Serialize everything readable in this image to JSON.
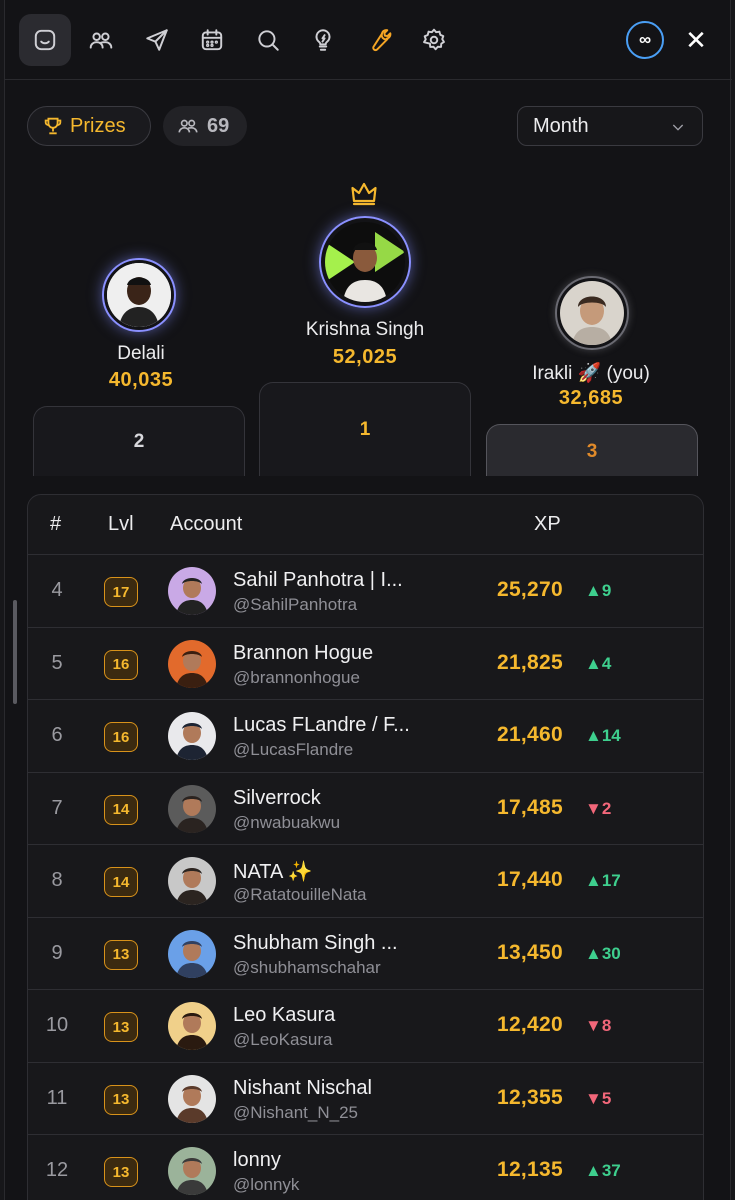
{
  "nav": {
    "items": [
      "home-icon",
      "users-icon",
      "send-icon",
      "calendar-icon",
      "search-icon",
      "lightbulb-icon",
      "wrench-icon",
      "gear-icon"
    ],
    "infinity_label": "∞",
    "close_label": "✕"
  },
  "filters": {
    "prizes_label": "Prizes",
    "members_count": "69",
    "period": "Month"
  },
  "podium": [
    {
      "place": "2",
      "name": "Delali",
      "xp": "40,035"
    },
    {
      "place": "1",
      "name": "Krishna Singh",
      "xp": "52,025"
    },
    {
      "place": "3",
      "name": "Irakli 🚀 (you)",
      "xp": "32,685"
    }
  ],
  "table": {
    "headers": {
      "rank": "#",
      "lvl": "Lvl",
      "account": "Account",
      "xp": "XP"
    },
    "rows": [
      {
        "rank": "4",
        "lvl": "17",
        "name": "Sahil Panhotra | I...",
        "handle": "@SahilPanhotra",
        "xp": "25,270",
        "change": "▲9",
        "dir": "up"
      },
      {
        "rank": "5",
        "lvl": "16",
        "name": "Brannon Hogue",
        "handle": "@brannonhogue",
        "xp": "21,825",
        "change": "▲4",
        "dir": "up"
      },
      {
        "rank": "6",
        "lvl": "16",
        "name": "Lucas FLandre / F...",
        "handle": "@LucasFlandre",
        "xp": "21,460",
        "change": "▲14",
        "dir": "up"
      },
      {
        "rank": "7",
        "lvl": "14",
        "name": "Silverrock",
        "handle": "@nwabuakwu",
        "xp": "17,485",
        "change": "▼2",
        "dir": "down"
      },
      {
        "rank": "8",
        "lvl": "14",
        "name": "NATA ✨",
        "handle": "@RatatouilleNata",
        "xp": "17,440",
        "change": "▲17",
        "dir": "up"
      },
      {
        "rank": "9",
        "lvl": "13",
        "name": "Shubham Singh ...",
        "handle": "@shubhamschahar",
        "xp": "13,450",
        "change": "▲30",
        "dir": "up"
      },
      {
        "rank": "10",
        "lvl": "13",
        "name": "Leo Kasura",
        "handle": "@LeoKasura",
        "xp": "12,420",
        "change": "▼8",
        "dir": "down"
      },
      {
        "rank": "11",
        "lvl": "13",
        "name": "Nishant Nischal",
        "handle": "@Nishant_N_25",
        "xp": "12,355",
        "change": "▼5",
        "dir": "down"
      },
      {
        "rank": "12",
        "lvl": "13",
        "name": "lonny",
        "handle": "@lonnyk",
        "xp": "12,135",
        "change": "▲37",
        "dir": "up"
      }
    ]
  },
  "colors": {
    "accent": "#f5b82e",
    "up": "#3ecf8e",
    "down": "#f2677a",
    "ring": "#8a90ff"
  }
}
